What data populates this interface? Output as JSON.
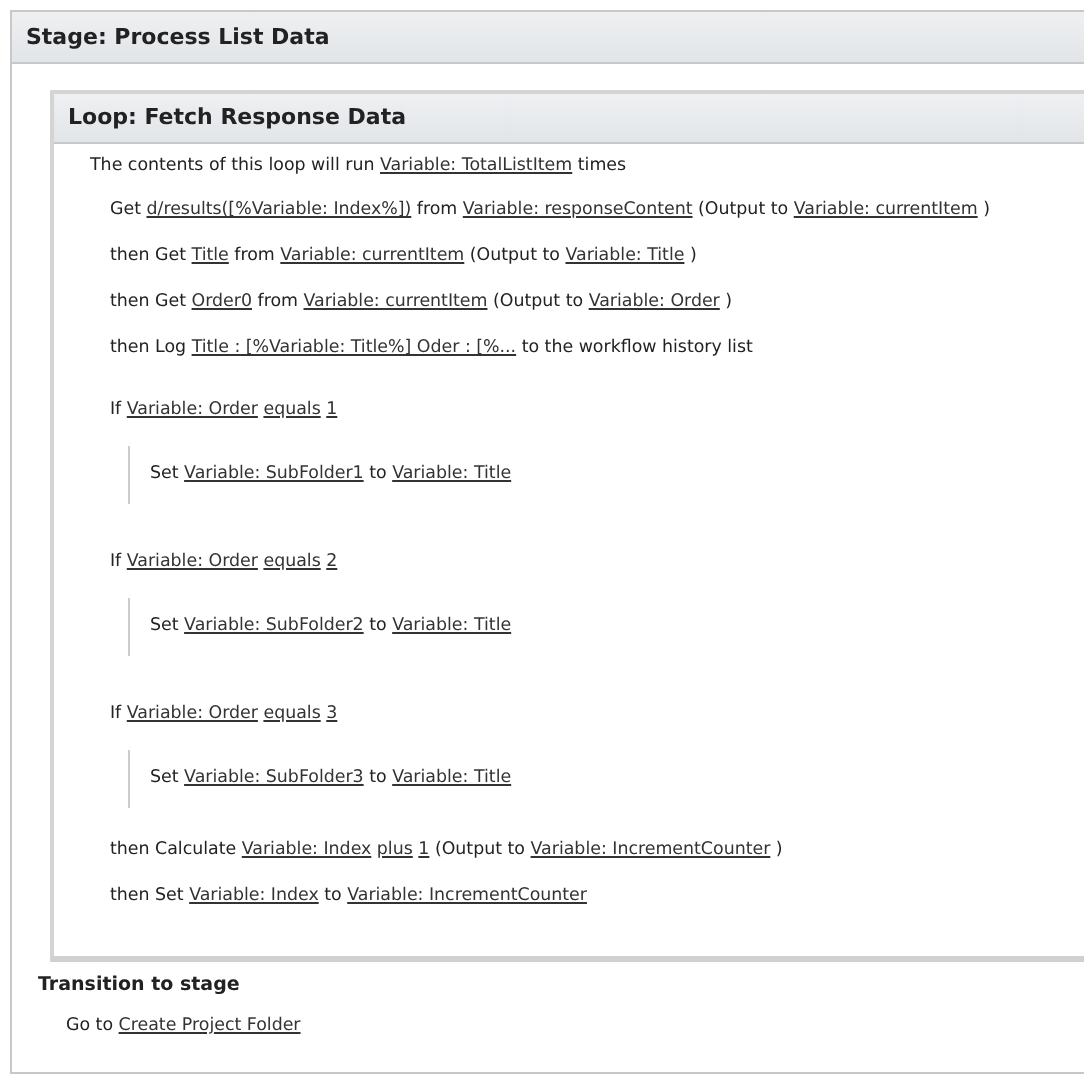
{
  "stage": {
    "title": "Stage: Process List Data",
    "loop": {
      "title": "Loop: Fetch Response Data",
      "description": [
        {
          "text": "The contents of this loop will run",
          "kind": "text"
        },
        {
          "text": "Variable: TotalListItem",
          "kind": "link"
        },
        {
          "text": "times",
          "kind": "text"
        }
      ],
      "steps": [
        {
          "kind": "action",
          "parts": [
            {
              "text": "Get",
              "kind": "text"
            },
            {
              "text": "d/results([%Variable: Index%])",
              "kind": "link"
            },
            {
              "text": "from",
              "kind": "text"
            },
            {
              "text": "Variable: responseContent",
              "kind": "link"
            },
            {
              "text": "(Output to",
              "kind": "text"
            },
            {
              "text": "Variable: currentItem",
              "kind": "link"
            },
            {
              "text": ")",
              "kind": "text"
            }
          ]
        },
        {
          "kind": "action",
          "parts": [
            {
              "text": "then Get",
              "kind": "text"
            },
            {
              "text": "Title",
              "kind": "link"
            },
            {
              "text": "from",
              "kind": "text"
            },
            {
              "text": "Variable: currentItem",
              "kind": "link"
            },
            {
              "text": "(Output to",
              "kind": "text"
            },
            {
              "text": "Variable: Title",
              "kind": "link"
            },
            {
              "text": ")",
              "kind": "text"
            }
          ]
        },
        {
          "kind": "action",
          "parts": [
            {
              "text": "then Get",
              "kind": "text"
            },
            {
              "text": "Order0",
              "kind": "link"
            },
            {
              "text": "from",
              "kind": "text"
            },
            {
              "text": "Variable: currentItem",
              "kind": "link"
            },
            {
              "text": "(Output to",
              "kind": "text"
            },
            {
              "text": "Variable: Order",
              "kind": "link"
            },
            {
              "text": ")",
              "kind": "text"
            }
          ]
        },
        {
          "kind": "action",
          "parts": [
            {
              "text": "then Log",
              "kind": "text"
            },
            {
              "text": "Title : [%Variable: Title%] Oder : [%...",
              "kind": "link"
            },
            {
              "text": "to the workflow history list",
              "kind": "text"
            }
          ]
        },
        {
          "kind": "condition",
          "parts": [
            {
              "text": "If",
              "kind": "text"
            },
            {
              "text": "Variable: Order",
              "kind": "link"
            },
            {
              "text": "equals",
              "kind": "link"
            },
            {
              "text": "1",
              "kind": "link"
            }
          ],
          "children": [
            {
              "kind": "action",
              "parts": [
                {
                  "text": "Set",
                  "kind": "text"
                },
                {
                  "text": "Variable: SubFolder1",
                  "kind": "link"
                },
                {
                  "text": "to",
                  "kind": "text"
                },
                {
                  "text": "Variable: Title",
                  "kind": "link"
                }
              ]
            }
          ]
        },
        {
          "kind": "condition",
          "parts": [
            {
              "text": "If",
              "kind": "text"
            },
            {
              "text": "Variable: Order",
              "kind": "link"
            },
            {
              "text": "equals",
              "kind": "link"
            },
            {
              "text": "2",
              "kind": "link"
            }
          ],
          "children": [
            {
              "kind": "action",
              "parts": [
                {
                  "text": "Set",
                  "kind": "text"
                },
                {
                  "text": "Variable: SubFolder2",
                  "kind": "link"
                },
                {
                  "text": "to",
                  "kind": "text"
                },
                {
                  "text": "Variable: Title",
                  "kind": "link"
                }
              ]
            }
          ]
        },
        {
          "kind": "condition",
          "parts": [
            {
              "text": "If",
              "kind": "text"
            },
            {
              "text": "Variable: Order",
              "kind": "link"
            },
            {
              "text": "equals",
              "kind": "link"
            },
            {
              "text": "3",
              "kind": "link"
            }
          ],
          "children": [
            {
              "kind": "action",
              "parts": [
                {
                  "text": "Set",
                  "kind": "text"
                },
                {
                  "text": "Variable: SubFolder3",
                  "kind": "link"
                },
                {
                  "text": "to",
                  "kind": "text"
                },
                {
                  "text": "Variable: Title",
                  "kind": "link"
                }
              ]
            }
          ]
        },
        {
          "kind": "action",
          "parts": [
            {
              "text": "then Calculate",
              "kind": "text"
            },
            {
              "text": "Variable: Index",
              "kind": "link"
            },
            {
              "text": "plus",
              "kind": "link"
            },
            {
              "text": "1",
              "kind": "link"
            },
            {
              "text": "(Output to",
              "kind": "text"
            },
            {
              "text": "Variable: IncrementCounter",
              "kind": "link"
            },
            {
              "text": ")",
              "kind": "text"
            }
          ]
        },
        {
          "kind": "action",
          "parts": [
            {
              "text": "then Set",
              "kind": "text"
            },
            {
              "text": "Variable: Index",
              "kind": "link"
            },
            {
              "text": "to",
              "kind": "text"
            },
            {
              "text": "Variable: IncrementCounter",
              "kind": "link"
            }
          ]
        }
      ]
    },
    "transition": {
      "title": "Transition to stage",
      "parts": [
        {
          "text": "Go to",
          "kind": "text"
        },
        {
          "text": "Create Project Folder",
          "kind": "link"
        }
      ]
    }
  }
}
